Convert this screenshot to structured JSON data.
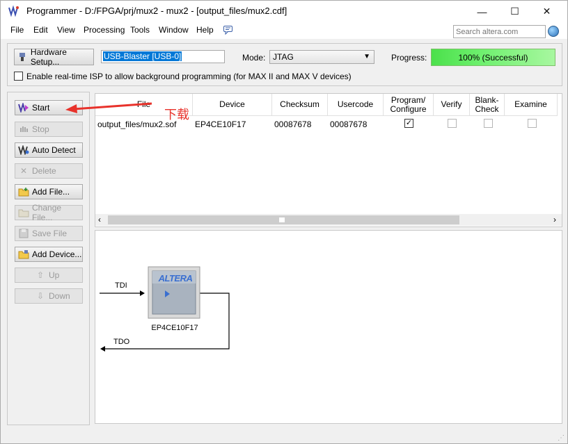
{
  "window": {
    "title": "Programmer - D:/FPGA/prj/mux2 - mux2 - [output_files/mux2.cdf]",
    "minimize": "—",
    "maximize": "☐",
    "close": "✕"
  },
  "menu": {
    "file": "File",
    "edit": "Edit",
    "view": "View",
    "processing": "Processing",
    "tools": "Tools",
    "window": "Window",
    "help": "Help"
  },
  "search": {
    "placeholder": "Search altera.com"
  },
  "hardware": {
    "setup_button": "Hardware Setup...",
    "device_value": "USB-Blaster [USB-0]",
    "mode_label": "Mode:",
    "mode_value": "JTAG",
    "progress_label": "Progress:",
    "progress_text": "100% (Successful)",
    "progress_fraction": 1.0,
    "isp_label": "Enable real-time ISP to allow background programming (for MAX II and MAX V devices)"
  },
  "side_buttons": {
    "start": "Start",
    "stop": "Stop",
    "auto_detect": "Auto Detect",
    "delete": "Delete",
    "add_file": "Add File...",
    "change_file": "Change File...",
    "save_file": "Save File",
    "add_device": "Add Device...",
    "up": "Up",
    "down": "Down"
  },
  "table": {
    "headers": {
      "file": "File",
      "device": "Device",
      "checksum": "Checksum",
      "usercode": "Usercode",
      "program_l1": "Program/",
      "program_l2": "Configure",
      "verify": "Verify",
      "blank_l1": "Blank-",
      "blank_l2": "Check",
      "examine": "Examine"
    },
    "row": {
      "file": "output_files/mux2.sof",
      "device": "EP4CE10F17",
      "checksum": "00087678",
      "usercode": "00087678",
      "program": true,
      "verify": false,
      "blank_check": false,
      "examine": false
    }
  },
  "diagram": {
    "chip_logo": "ALTERA",
    "chip_name": "EP4CE10F17",
    "tdi": "TDI",
    "tdo": "TDO"
  },
  "annotation": {
    "text": "下载",
    "color": "#e8322b"
  }
}
